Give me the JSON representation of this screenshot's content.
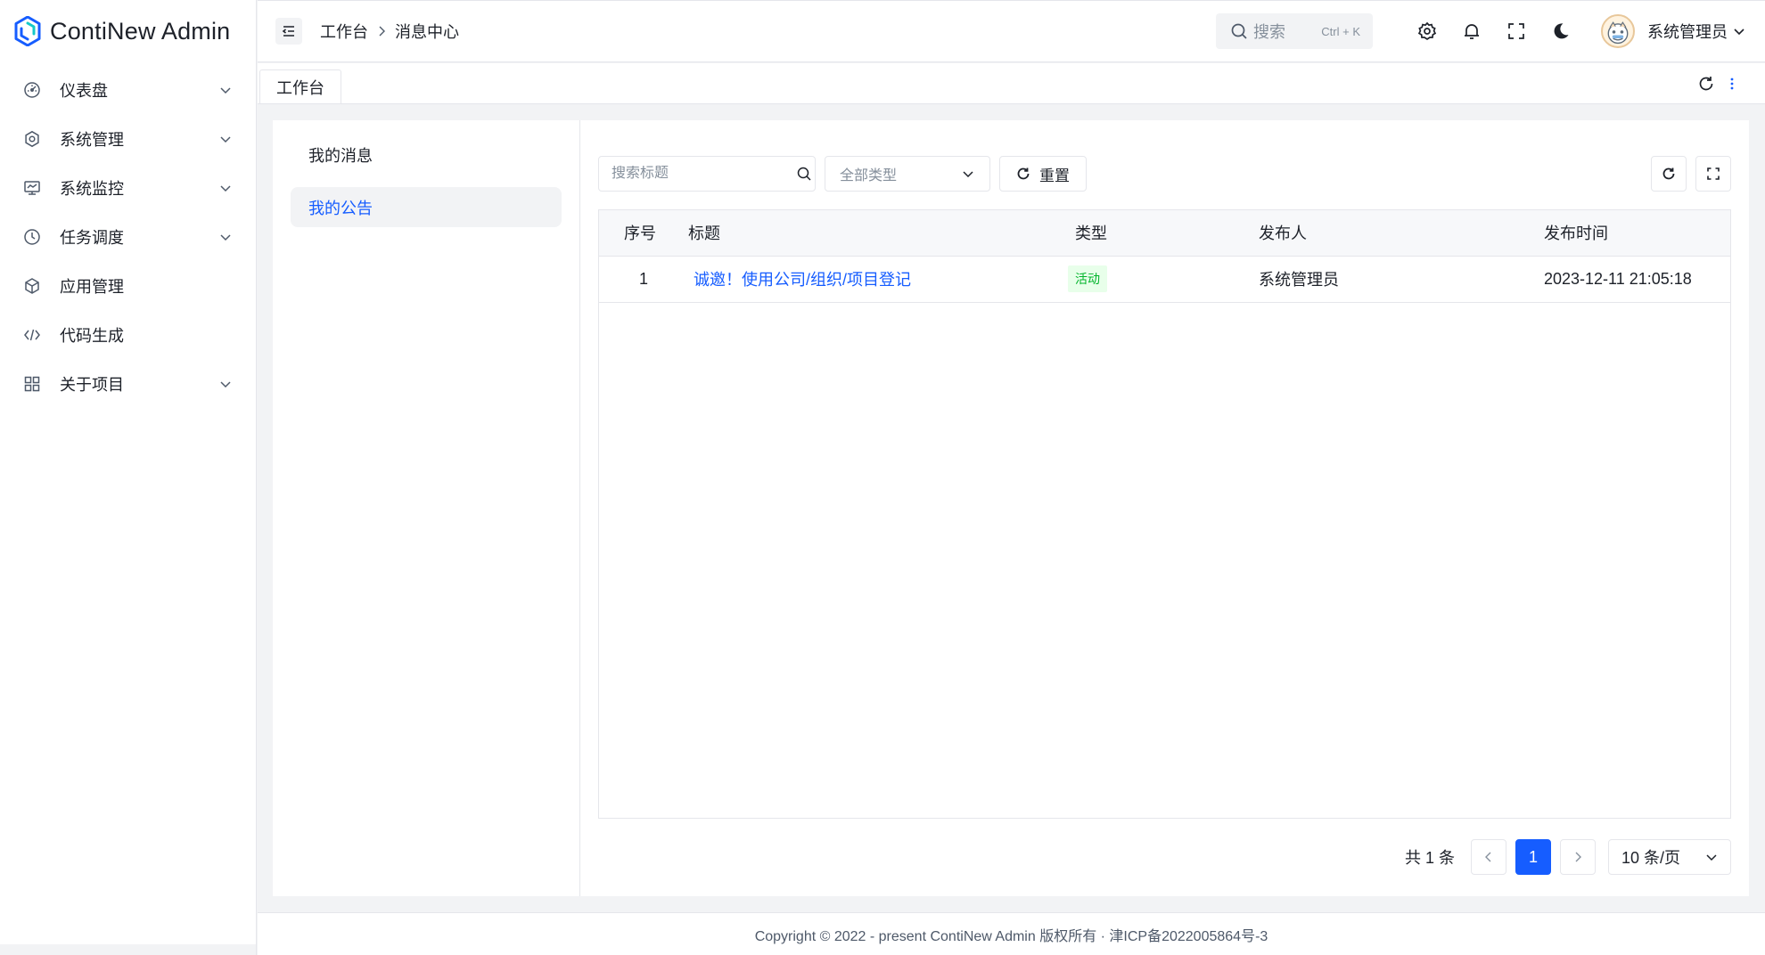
{
  "app": {
    "title": "ContiNew Admin"
  },
  "sidebar": {
    "items": [
      {
        "label": "仪表盘",
        "icon": "dashboard-icon",
        "expandable": true
      },
      {
        "label": "系统管理",
        "icon": "settings-icon",
        "expandable": true
      },
      {
        "label": "系统监控",
        "icon": "monitor-icon",
        "expandable": true
      },
      {
        "label": "任务调度",
        "icon": "clock-icon",
        "expandable": true
      },
      {
        "label": "应用管理",
        "icon": "cube-icon",
        "expandable": false
      },
      {
        "label": "代码生成",
        "icon": "code-icon",
        "expandable": false
      },
      {
        "label": "关于项目",
        "icon": "apps-icon",
        "expandable": true
      }
    ]
  },
  "header": {
    "breadcrumb": [
      "工作台",
      "消息中心"
    ],
    "search_label": "搜索",
    "search_shortcut": "Ctrl + K",
    "user_name": "系统管理员"
  },
  "tabs": [
    {
      "label": "工作台"
    }
  ],
  "message_center": {
    "nav": [
      {
        "label": "我的消息",
        "active": false
      },
      {
        "label": "我的公告",
        "active": true
      }
    ],
    "filters": {
      "search_placeholder": "搜索标题",
      "type_placeholder": "全部类型",
      "reset_label": "重置"
    },
    "table": {
      "columns": [
        "序号",
        "标题",
        "类型",
        "发布人",
        "发布时间"
      ],
      "rows": [
        {
          "index": "1",
          "title": "诚邀！使用公司/组织/项目登记",
          "type": "活动",
          "publisher": "系统管理员",
          "published_at": "2023-12-11 21:05:18"
        }
      ]
    },
    "pagination": {
      "total_label": "共 1 条",
      "current_page": "1",
      "page_size_label": "10 条/页"
    }
  },
  "footer": {
    "copyright": "Copyright © 2022 - present ContiNew Admin 版权所有 · 津ICP备2022005864号-3"
  },
  "colors": {
    "primary": "#165dff",
    "success_text": "#00b42a",
    "success_bg": "#e8ffea",
    "border": "#e5e6eb",
    "page_bg": "#f2f3f5"
  }
}
